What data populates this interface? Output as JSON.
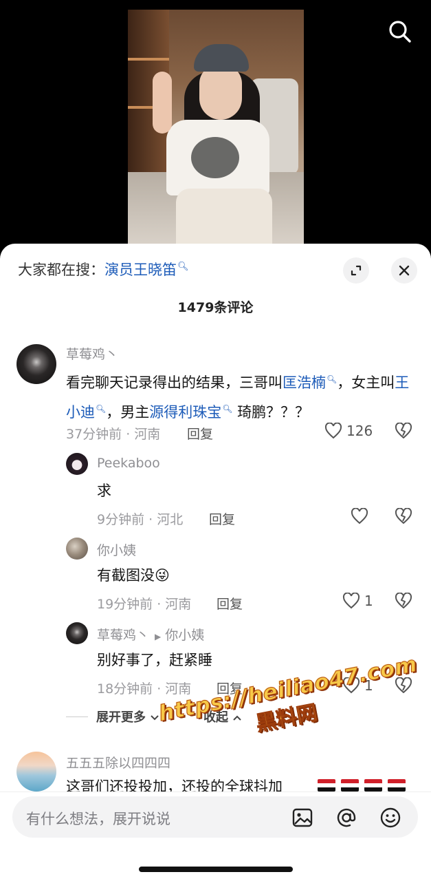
{
  "search_hint": {
    "prefix": "大家都在搜：",
    "term": "演员王晓笛"
  },
  "comment_count": "1479条评论",
  "comments": [
    {
      "user": "草莓鸡丶",
      "segments": [
        "看完聊天记录得出的结果，三哥叫",
        "匡浩楠",
        "，女主叫",
        "王小迪",
        "，男主",
        "源得利珠宝",
        " 琦鹏？？？"
      ],
      "time_loc": "37分钟前 · 河南",
      "reply_label": "回复",
      "likes": "126"
    },
    {
      "user": "Peekaboo",
      "text": "求",
      "time_loc": "9分钟前 · 河北",
      "reply_label": "回复",
      "likes": ""
    },
    {
      "user": "你小姨",
      "text": "有截图没😜",
      "time_loc": "19分钟前 · 河南",
      "reply_label": "回复",
      "likes": "1"
    },
    {
      "user": "草莓鸡丶",
      "reply_to": "你小姨",
      "text": "别好事了，赶紧睡",
      "time_loc": "18分钟前 · 河南",
      "reply_label": "回复",
      "likes": "1"
    },
    {
      "user": "五五五除以四四四",
      "text": "这哥们还投投加，还投的全球抖加"
    }
  ],
  "expand_more": "展开更多",
  "collapse": "收起",
  "input_placeholder": "有什么想法，展开说说",
  "watermark": {
    "url": "https://heiliao47.com",
    "cn": "黑料网"
  },
  "colors": {
    "link_blue": "#1c5bb8",
    "meta_grey": "#9a9a9e",
    "watermark_gold": "#f7c948"
  }
}
